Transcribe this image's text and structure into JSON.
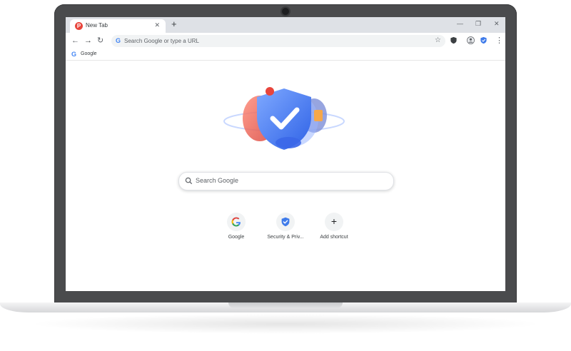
{
  "tab": {
    "title": "New Tab",
    "close": "✕",
    "new_tab": "+"
  },
  "window_controls": {
    "minimize": "—",
    "maximize": "❐",
    "close": "✕"
  },
  "toolbar": {
    "back": "←",
    "forward": "→",
    "reload": "↻",
    "omnibox_placeholder": "Search Google or type a URL",
    "star": "☆",
    "menu": "⋮"
  },
  "bookmarks": [
    {
      "label": "Google",
      "icon": "google-g-icon"
    }
  ],
  "ntp": {
    "search_placeholder": "Search Google",
    "shortcuts": [
      {
        "label": "Google",
        "icon": "google-g-icon"
      },
      {
        "label": "Security & Priv...",
        "icon": "shield-check-icon"
      },
      {
        "label": "Add shortcut",
        "icon": "plus-icon",
        "glyph": "+"
      }
    ]
  },
  "colors": {
    "accent": "#4285f4",
    "shield": "#3f7bea",
    "hero_red": "#e8453c"
  }
}
